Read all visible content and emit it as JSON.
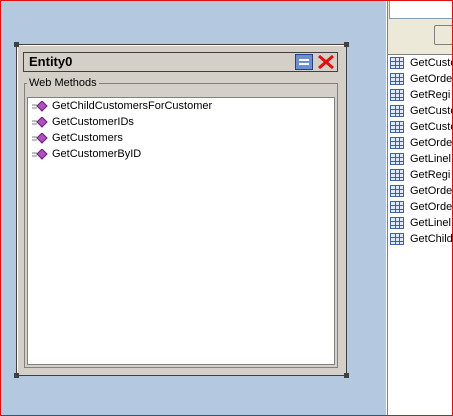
{
  "entity_window": {
    "title": "Entity0",
    "group_label": "Web Methods",
    "methods": [
      {
        "label": "GetChildCustomersForCustomer",
        "icon": "method-icon"
      },
      {
        "label": "GetCustomerIDs",
        "icon": "method-icon"
      },
      {
        "label": "GetCustomers",
        "icon": "method-icon"
      },
      {
        "label": "GetCustomerByID",
        "icon": "method-icon"
      }
    ]
  },
  "right_panel": {
    "items": [
      {
        "label": "GetCusto"
      },
      {
        "label": "GetOrde"
      },
      {
        "label": "GetRegi"
      },
      {
        "label": "GetCusto"
      },
      {
        "label": "GetCusto"
      },
      {
        "label": "GetOrde"
      },
      {
        "label": "GetLinel"
      },
      {
        "label": "GetRegi"
      },
      {
        "label": "GetOrde"
      },
      {
        "label": "GetOrde"
      },
      {
        "label": "GetLinel"
      },
      {
        "label": "GetChild"
      }
    ]
  },
  "colors": {
    "canvas": "#b4c8e0",
    "window_face": "#d4d0c8",
    "accent_red": "#e01010",
    "method_icon": "#b050c0"
  }
}
